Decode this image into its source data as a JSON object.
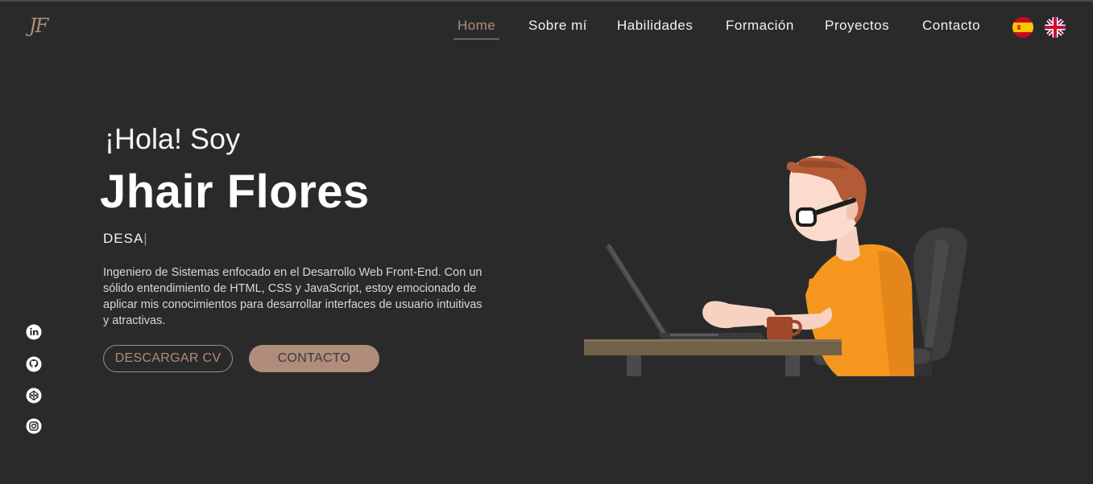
{
  "logo": "JF",
  "nav": {
    "items": [
      "Home",
      "Sobre mí",
      "Habilidades",
      "Formación",
      "Proyectos",
      "Contacto"
    ],
    "active": "Home"
  },
  "languages": [
    "es-flag-icon",
    "uk-flag-icon"
  ],
  "hero": {
    "greeting": "¡Hola! Soy",
    "name": "Jhair Flores",
    "role_typed": "DESA",
    "description": "Ingeniero de Sistemas enfocado en el Desarrollo Web Front-End. Con un sólido entendimiento de HTML, CSS y JavaScript, estoy emocionado de aplicar mis conocimientos para desarrollar interfaces de usuario intuitivas y atractivas.",
    "btn_cv": "DESCARGAR CV",
    "btn_contact": "CONTACTO"
  },
  "social": [
    "linkedin-icon",
    "github-icon",
    "codepen-icon",
    "instagram-icon"
  ],
  "colors": {
    "accent": "#b08c7a",
    "background": "#2a2a2a",
    "shirt": "#f5961e"
  }
}
